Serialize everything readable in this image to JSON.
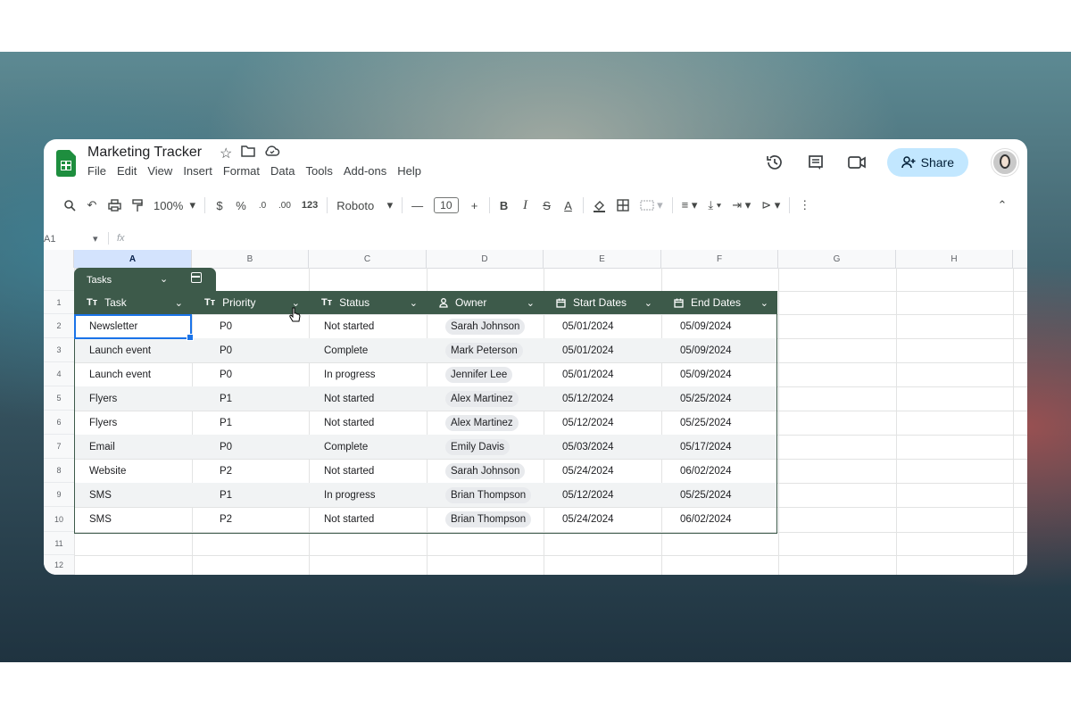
{
  "app": {
    "doc_title": "Marketing Tracker",
    "menu": [
      "File",
      "Edit",
      "View",
      "Insert",
      "Format",
      "Data",
      "Tools",
      "Add-ons",
      "Help"
    ],
    "share_label": "Share",
    "title_icons": [
      "star-icon",
      "folder-icon",
      "cloud-status-icon"
    ],
    "right_icons": [
      "history-icon",
      "comments-icon",
      "meet-icon"
    ]
  },
  "toolbar": {
    "zoom": "100%",
    "currency": "$",
    "percent": "%",
    "decrease_decimal": ".0",
    "increase_decimal": ".00",
    "number_format": "123",
    "font": "Roboto",
    "font_size": "10",
    "bold": "B",
    "italic": "I",
    "strike": "S",
    "text_color": "A"
  },
  "formula_bar": {
    "name_box": "A1",
    "fx": "fx"
  },
  "columns": [
    "A",
    "B",
    "C",
    "D",
    "E",
    "F",
    "G",
    "H"
  ],
  "rows": [
    "1",
    "2",
    "3",
    "4",
    "5",
    "6",
    "7",
    "8",
    "9",
    "10",
    "11",
    "12"
  ],
  "table": {
    "name": "Tasks",
    "headers": [
      {
        "type_icon": "Tт",
        "label": "Task"
      },
      {
        "type_icon": "Tт",
        "label": "Priority"
      },
      {
        "type_icon": "Tт",
        "label": "Status"
      },
      {
        "type_icon": "person",
        "label": "Owner"
      },
      {
        "type_icon": "calendar",
        "label": "Start Dates"
      },
      {
        "type_icon": "calendar",
        "label": "End Dates"
      }
    ],
    "rows": [
      [
        "Newsletter",
        "P0",
        "Not started",
        "Sarah Johnson",
        "05/01/2024",
        "05/09/2024"
      ],
      [
        "Launch event",
        "P0",
        "Complete",
        "Mark Peterson",
        "05/01/2024",
        "05/09/2024"
      ],
      [
        "Launch event",
        "P0",
        "In progress",
        "Jennifer Lee",
        "05/01/2024",
        "05/09/2024"
      ],
      [
        "Flyers",
        "P1",
        "Not started",
        "Alex Martinez",
        "05/12/2024",
        "05/25/2024"
      ],
      [
        "Flyers",
        "P1",
        "Not started",
        "Alex Martinez",
        "05/12/2024",
        "05/25/2024"
      ],
      [
        "Email",
        "P0",
        "Complete",
        "Emily Davis",
        "05/03/2024",
        "05/17/2024"
      ],
      [
        "Website",
        "P2",
        "Not started",
        "Sarah Johnson",
        "05/24/2024",
        "06/02/2024"
      ],
      [
        "SMS",
        "P1",
        "In progress",
        "Brian Thompson",
        "05/12/2024",
        "05/25/2024"
      ],
      [
        "SMS",
        "P2",
        "Not started",
        "Brian Thompson",
        "05/24/2024",
        "06/02/2024"
      ]
    ]
  },
  "colors": {
    "table_header": "#3d5a4a",
    "share_bg": "#c2e7ff",
    "selection": "#1a73e8",
    "logo": "#1e8e3e"
  }
}
